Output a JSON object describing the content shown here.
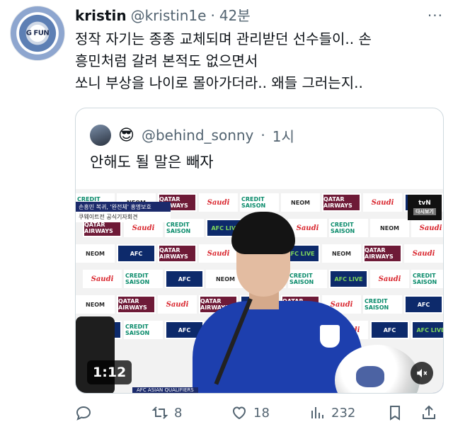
{
  "tweet": {
    "display_name": "kristin",
    "handle": "@kristin1e",
    "separator": "·",
    "time": "42분",
    "avatar_label": "G FUN",
    "more_label": "···",
    "text_lines": [
      "정작 자기는 종종 교체되며 관리받던 선수들이.. 손",
      "흥민처럼 갈려 본적도 없으면서",
      "쏘니 부상을 나이로 몰아가더라..  왜들 그러는지.."
    ]
  },
  "quote": {
    "emoji": "😎",
    "handle": "@behind_sonny",
    "separator": "·",
    "time": "1시",
    "text": "안해도 될 말은 빼자",
    "video": {
      "duration": "1:12",
      "caption_line1": "손흥민 복귀, '완전체' 홍명보호",
      "caption_line2": "쿠웨이트전 공식기자회견",
      "broadcast_logo": "tvN",
      "broadcast_tag": "다시보기",
      "ticker": "AFC ASIAN QUALIFIERS",
      "sponsors": {
        "qatar": "QATAR AIRWAYS",
        "saudi": "Saudi",
        "credit": "CREDIT SAISON",
        "neom": "NEOM",
        "afc": "AFC",
        "live": "AFC LIVE"
      }
    }
  },
  "actions": {
    "reply_count": "",
    "retweet_count": "8",
    "like_count": "18",
    "view_count": "232"
  },
  "colors": {
    "text": "#0f1419",
    "secondary": "#536471",
    "border": "#cfd9de"
  }
}
